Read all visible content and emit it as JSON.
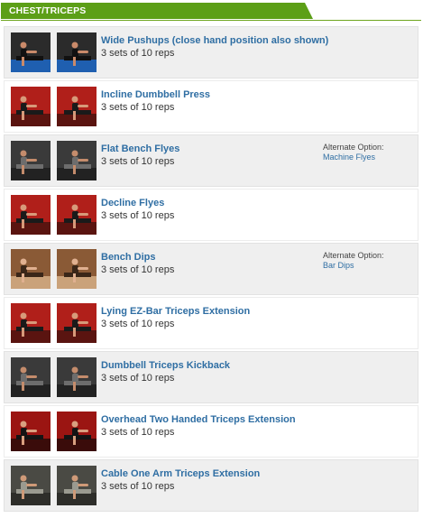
{
  "header": {
    "title": "CHEST/TRICEPS",
    "color": "#5c9f17"
  },
  "exercises": [
    {
      "name": "Wide Pushups (close hand position also shown)",
      "sets": "3 sets of 10 reps",
      "alt_label": "",
      "alt_link": "",
      "scene": "blue-mat"
    },
    {
      "name": "Incline Dumbbell Press",
      "sets": "3 sets of 10 reps",
      "alt_label": "",
      "alt_link": "",
      "scene": "red-bench"
    },
    {
      "name": "Flat Bench Flyes",
      "sets": "3 sets of 10 reps",
      "alt_label": "Alternate Option:",
      "alt_link": "Machine Flyes",
      "scene": "dark-gym"
    },
    {
      "name": "Decline Flyes",
      "sets": "3 sets of 10 reps",
      "alt_label": "",
      "alt_link": "",
      "scene": "red-bench"
    },
    {
      "name": "Bench Dips",
      "sets": "3 sets of 10 reps",
      "alt_label": "Alternate Option:",
      "alt_link": "Bar Dips",
      "scene": "brown-room"
    },
    {
      "name": "Lying EZ-Bar Triceps Extension",
      "sets": "3 sets of 10 reps",
      "alt_label": "",
      "alt_link": "",
      "scene": "red-bench"
    },
    {
      "name": "Dumbbell Triceps Kickback",
      "sets": "3 sets of 10 reps",
      "alt_label": "",
      "alt_link": "",
      "scene": "dark-gym"
    },
    {
      "name": "Overhead Two Handed Triceps Extension",
      "sets": "3 sets of 10 reps",
      "alt_label": "",
      "alt_link": "",
      "scene": "red-curtain"
    },
    {
      "name": "Cable One Arm Triceps Extension",
      "sets": "3 sets of 10 reps",
      "alt_label": "",
      "alt_link": "",
      "scene": "cable-gym"
    }
  ]
}
